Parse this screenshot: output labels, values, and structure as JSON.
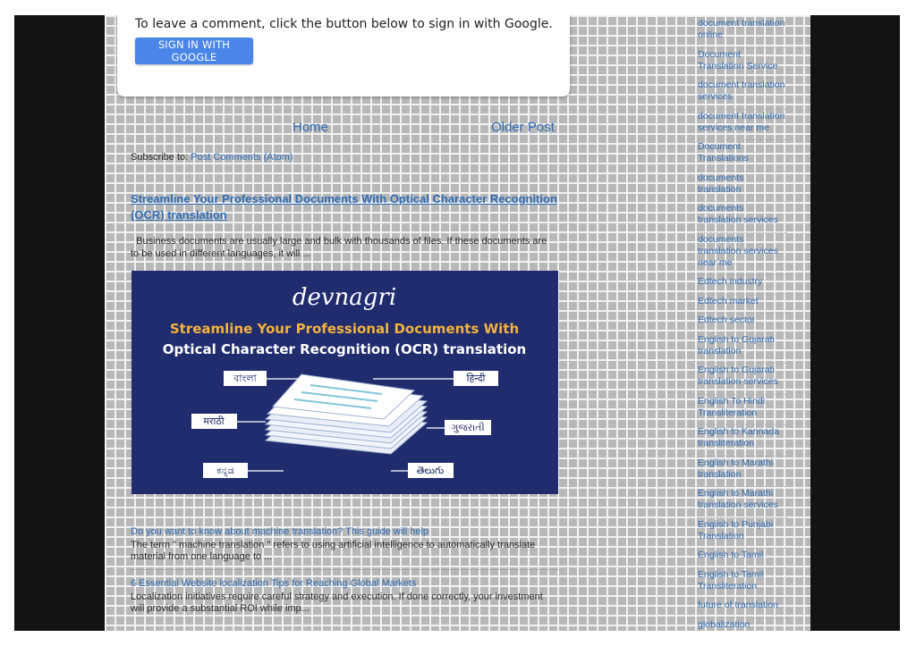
{
  "comments": {
    "prompt": "To leave a comment, click the button below to sign in with Google.",
    "signin_label": "SIGN IN WITH GOOGLE"
  },
  "pager": {
    "home": "Home",
    "older": "Older Post"
  },
  "subscribe": {
    "prefix": "Subscribe to:",
    "link": "Post Comments (Atom)"
  },
  "featured": {
    "title": "Streamline Your Professional Documents With Optical Character Recognition (OCR) translation",
    "snippet": "  Business documents are usually large and bulk with thousands of files. If these documents are to be used in different languages, it will ...",
    "image": {
      "brand": "devnagri",
      "headline_1": "Streamline Your Professional Documents With",
      "headline_2": "Optical Character Recognition (OCR) translation",
      "languages": [
        "বাংলা",
        "हिन्दी",
        "मराठी",
        "ગુજરાતી",
        "ಕನ್ನಡ",
        "తెలుగు"
      ],
      "colors": {
        "background": "#202c6e",
        "accent": "#f3b23c"
      }
    }
  },
  "related": [
    {
      "title": "Do you want to know about machine translation? This guide will help",
      "snippet": "The term \" machine translation \" refers to using artificial intelligence to automatically translate material from one language to ..."
    },
    {
      "title": "6 Essential Website localization Tips for Reaching Global Markets",
      "snippet": "Localization initiatives require careful strategy and execution. If done correctly, your investment will provide a substantial ROI while imp..."
    }
  ],
  "labels": [
    "document translation online",
    "Document Translation Service",
    "document translation services",
    "document translation services near me",
    "Document Translations",
    "documents translation",
    "documents translation services",
    "documents translation services near me",
    "Edtech industry",
    "Edtech market",
    "Edtech sector",
    "English to Gujarati translation",
    "English to Gujarati translation services",
    "English To Hindi Transliteration",
    "English to Kannada transliteration",
    "English to Marathi translation",
    "English to Marathi translation services",
    "English to Punjabi Translation",
    "English to Tamil",
    "English to Tamil Transliteration",
    "future of translation",
    "globalization"
  ]
}
